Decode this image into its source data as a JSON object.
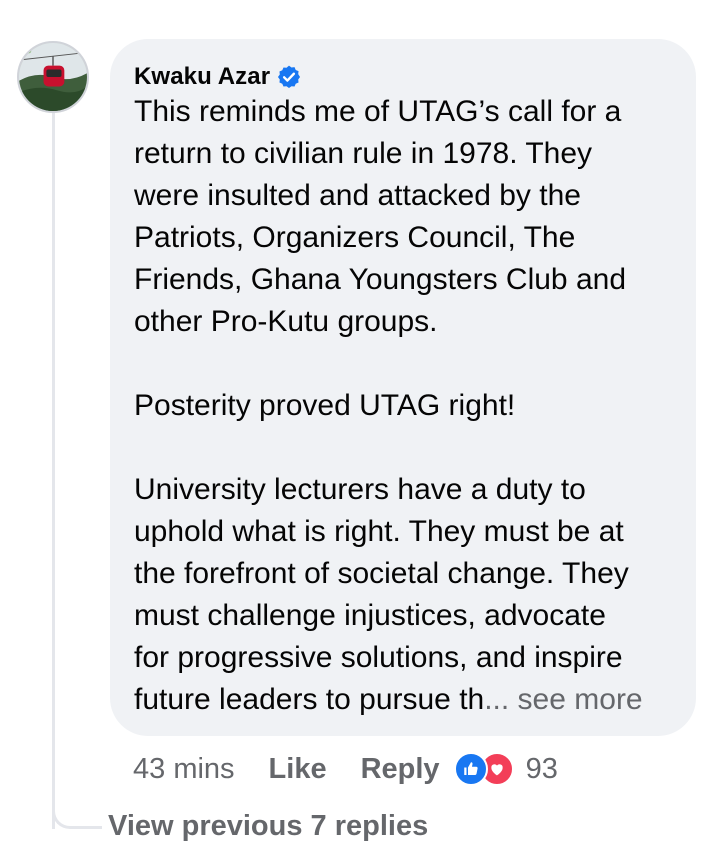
{
  "comment": {
    "author": "Kwaku Azar",
    "verified": true,
    "avatar_icon": "avatar-photo-cable-car",
    "text_main": "This reminds me of UTAG’s call for a\nreturn to civilian rule in 1978. They\nwere insulted and attacked by the\nPatriots, Organizers Council, The\nFriends, Ghana Youngsters Club and\nother Pro-Kutu groups.\n\nPosterity proved UTAG right!\n\nUniversity lecturers have a duty to\nuphold what is right. They must be at\nthe forefront of societal change. They\nmust challenge injustices, advocate\nfor progressive solutions, and inspire\nfuture leaders to pursue th",
    "see_more": "... see more"
  },
  "actions": {
    "time": "43 mins",
    "like_label": "Like",
    "reply_label": "Reply",
    "reaction_count": "93",
    "reaction_icons": [
      "like-reaction-icon",
      "love-reaction-icon"
    ]
  },
  "replies": {
    "view_previous_label": "View previous 7 replies"
  },
  "colors": {
    "bubble_bg": "#f0f2f5",
    "text": "#050505",
    "secondary_text": "#65676b",
    "verified_blue": "#1877f2",
    "love_red": "#f33e58"
  }
}
